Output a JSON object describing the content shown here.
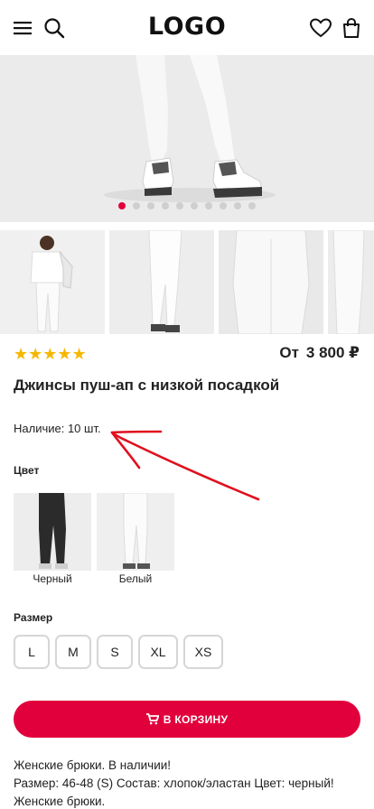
{
  "header": {
    "logo": "LOGO",
    "icons": [
      "menu-icon",
      "search-icon",
      "heart-icon",
      "bag-icon"
    ]
  },
  "gallery": {
    "slides_count": 10,
    "active_slide": 1
  },
  "product": {
    "rating_stars": 5,
    "stars_text": "★★★★★",
    "price_prefix": "От",
    "price": "3 800 ₽",
    "title": "Джинсы пуш-ап с низкой посадкой",
    "stock": "Наличие: 10 шт."
  },
  "colors": {
    "heading": "Цвет",
    "options": [
      {
        "label": "Черный"
      },
      {
        "label": "Белый"
      }
    ]
  },
  "sizes": {
    "heading": "Размер",
    "options": [
      "L",
      "M",
      "S",
      "XL",
      "XS"
    ]
  },
  "cart": {
    "label": "В КОРЗИНУ"
  },
  "description": {
    "lines": [
      "Женские брюки. В наличии!",
      "Размер: 46-48 (S) Состав: хлопок/эластан Цвет: черный!",
      "Женские брюки."
    ]
  },
  "theme": {
    "accent": "#e2003c",
    "star": "#f5b800",
    "annotation": "#e0101e"
  }
}
